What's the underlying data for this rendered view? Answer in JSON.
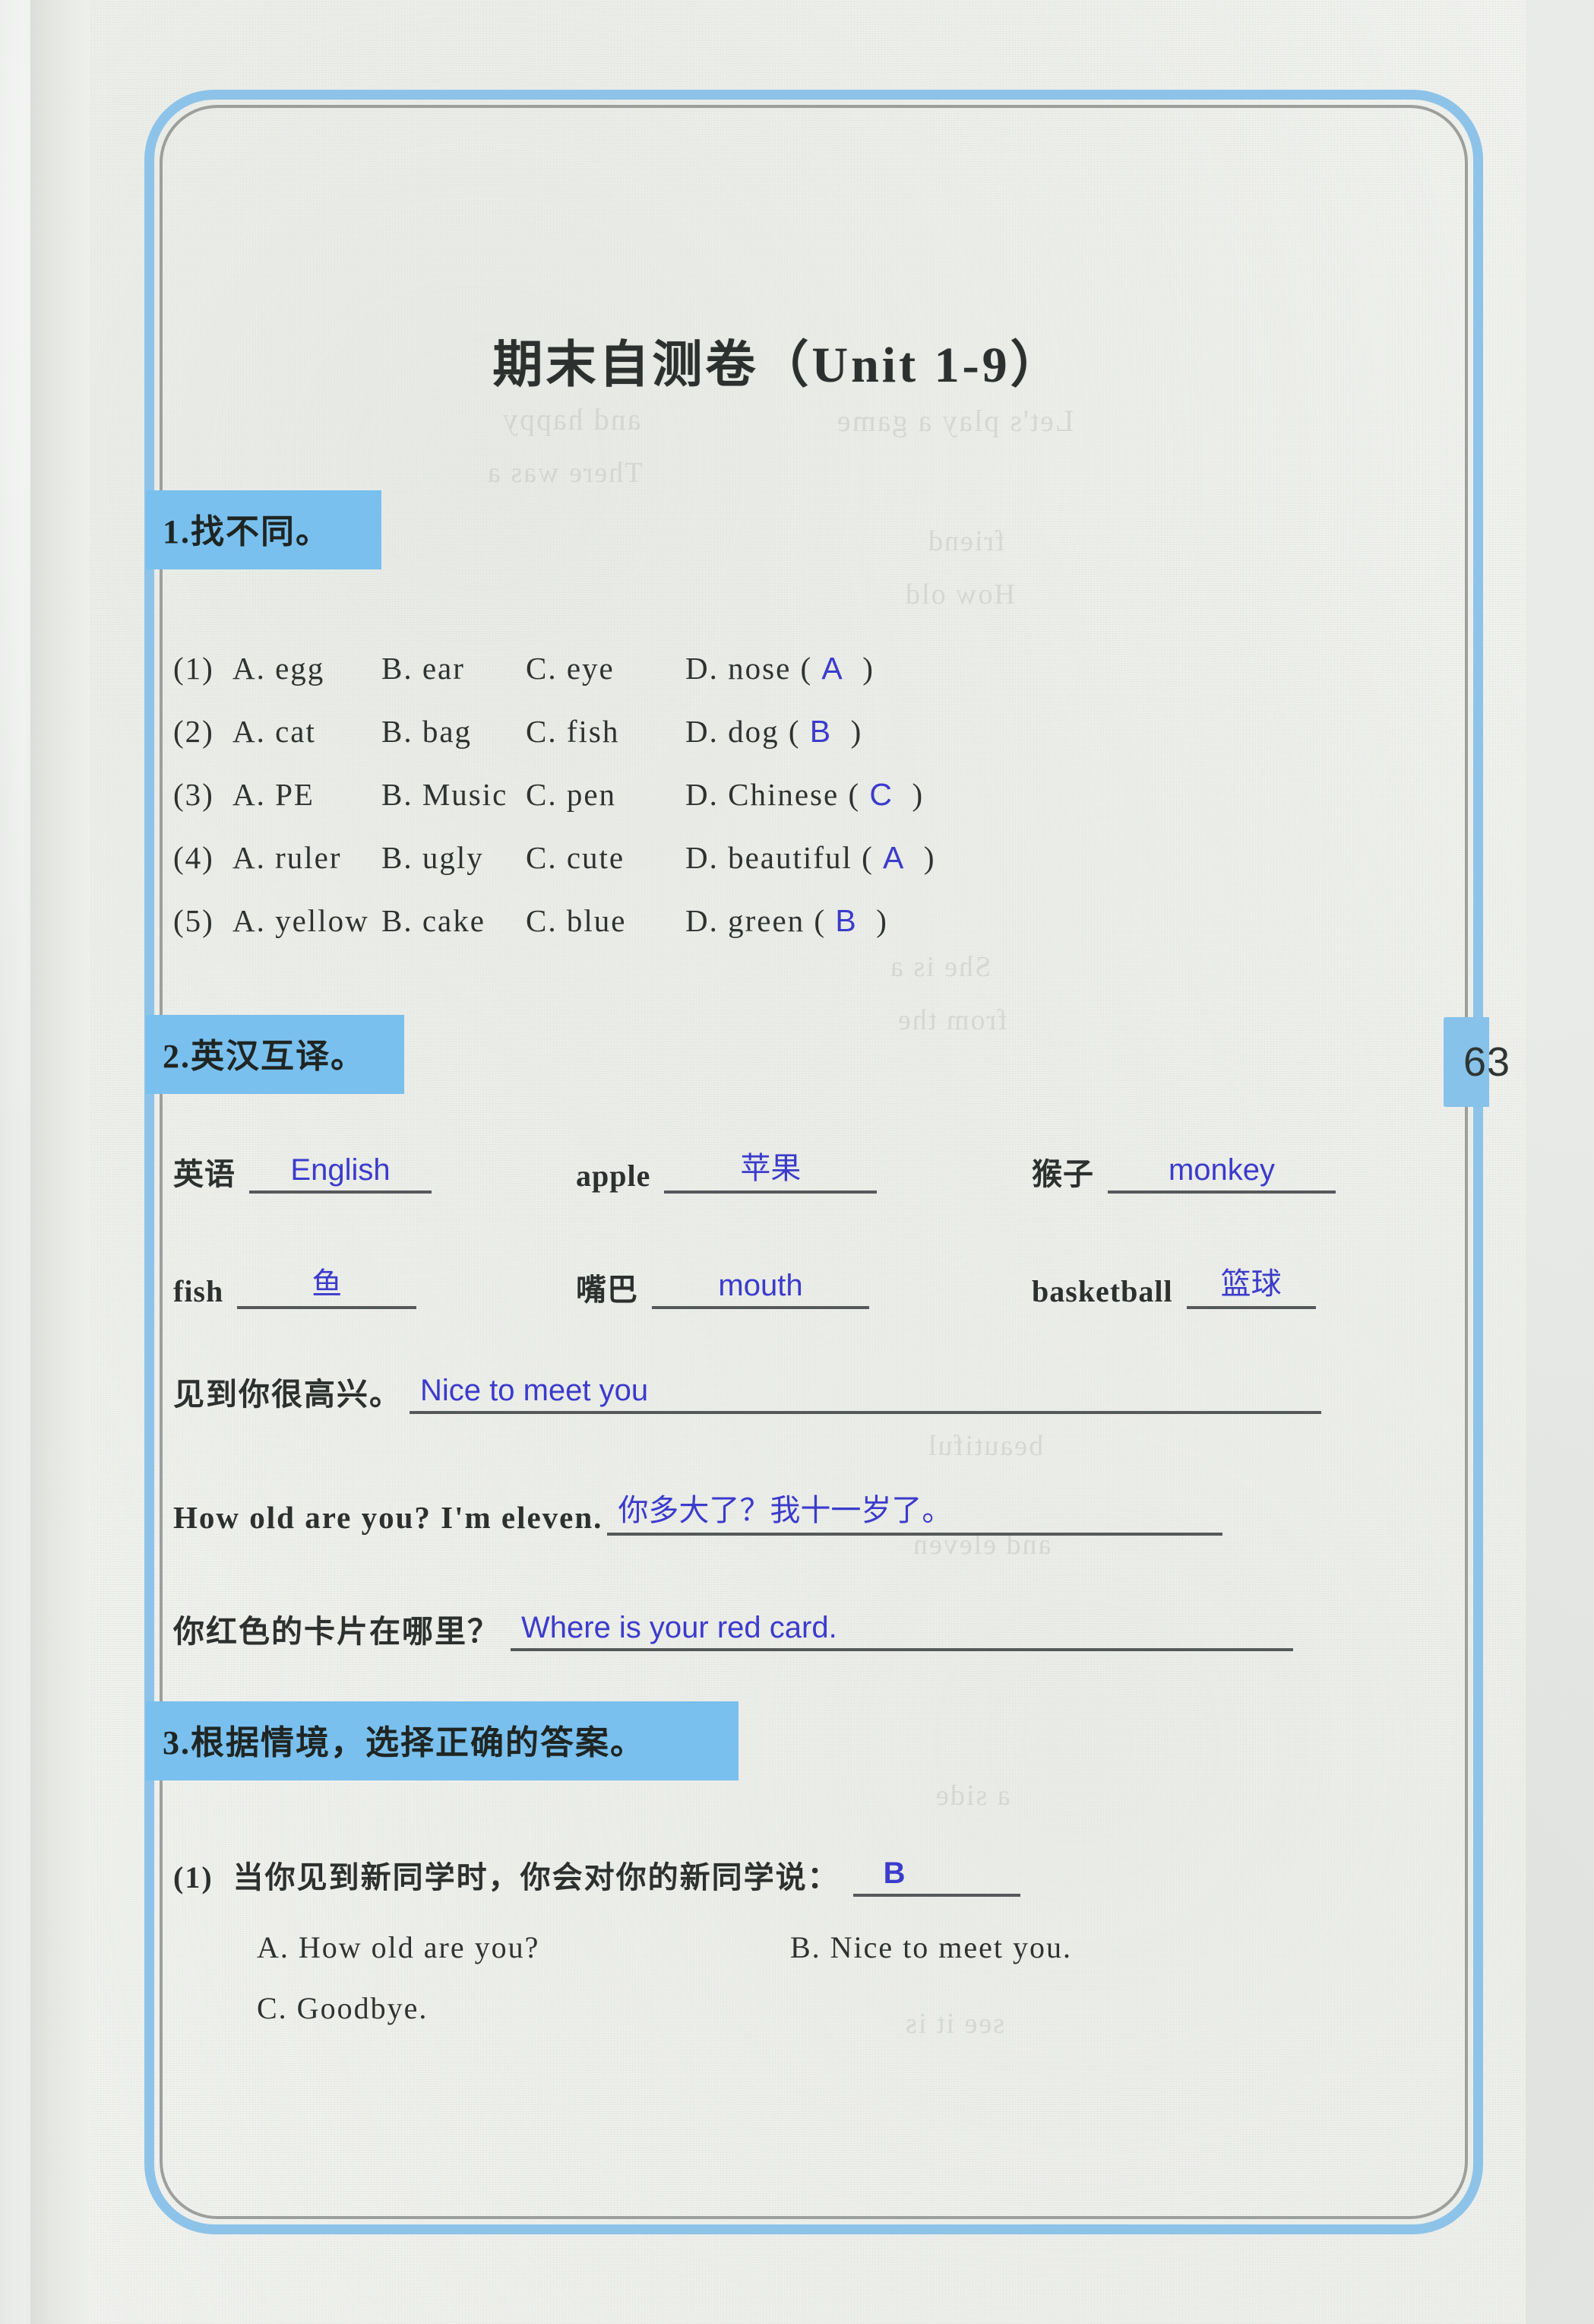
{
  "page": {
    "number": "63"
  },
  "title": "期末自测卷（Unit 1-9）",
  "sections": [
    {
      "heading": "1.找不同。",
      "questions": [
        {
          "num": "(1)",
          "a": "A. egg",
          "b": "B. ear",
          "c": "C. eye",
          "d": "D. nose",
          "answer": "A"
        },
        {
          "num": "(2)",
          "a": "A. cat",
          "b": "B. bag",
          "c": "C. fish",
          "d": "D. dog",
          "answer": "B"
        },
        {
          "num": "(3)",
          "a": "A. PE",
          "b": "B. Music",
          "c": "C. pen",
          "d": "D. Chinese",
          "answer": "C"
        },
        {
          "num": "(4)",
          "a": "A. ruler",
          "b": "B. ugly",
          "c": "C. cute",
          "d": "D. beautiful",
          "answer": "A"
        },
        {
          "num": "(5)",
          "a": "A. yellow",
          "b": "B. cake",
          "c": "C. blue",
          "d": "D. green",
          "answer": "B"
        }
      ]
    },
    {
      "heading": "2.英汉互译。",
      "words": [
        {
          "prompt": "英语",
          "answer": "English"
        },
        {
          "prompt": "apple",
          "answer": "苹果"
        },
        {
          "prompt": "猴子",
          "answer": "monkey"
        },
        {
          "prompt": "fish",
          "answer": "鱼"
        },
        {
          "prompt": "嘴巴",
          "answer": "mouth"
        },
        {
          "prompt": "basketball",
          "answer": "篮球"
        }
      ],
      "sentences": [
        {
          "prompt": "见到你很高兴。",
          "answer": "Nice to meet you"
        },
        {
          "prompt": "How old are you? I'm eleven.",
          "answer": "你多大了？我十一岁了。"
        },
        {
          "prompt": "你红色的卡片在哪里？",
          "answer": "Where is your red card."
        }
      ]
    },
    {
      "heading": "3.根据情境，选择正确的答案。",
      "questions": [
        {
          "num": "(1)",
          "stem": "当你见到新同学时，你会对你的新同学说：",
          "answer": "B",
          "options": [
            "A. How old are you?",
            "B. Nice to meet you.",
            "C. Goodbye."
          ]
        }
      ]
    }
  ],
  "colors": {
    "frame_blue": "#8dc3e8",
    "header_blue": "#79c0ee",
    "ink_blue": "#3b3bcc",
    "print_black": "#2c302e",
    "paper": "#f2f3f0"
  },
  "showthrough": [
    "and happy",
    "There was a",
    "Let's play a game",
    "friend",
    "beautiful",
    "How old",
    "and eleven",
    "a side",
    "She is a",
    "from the",
    "see it is"
  ]
}
